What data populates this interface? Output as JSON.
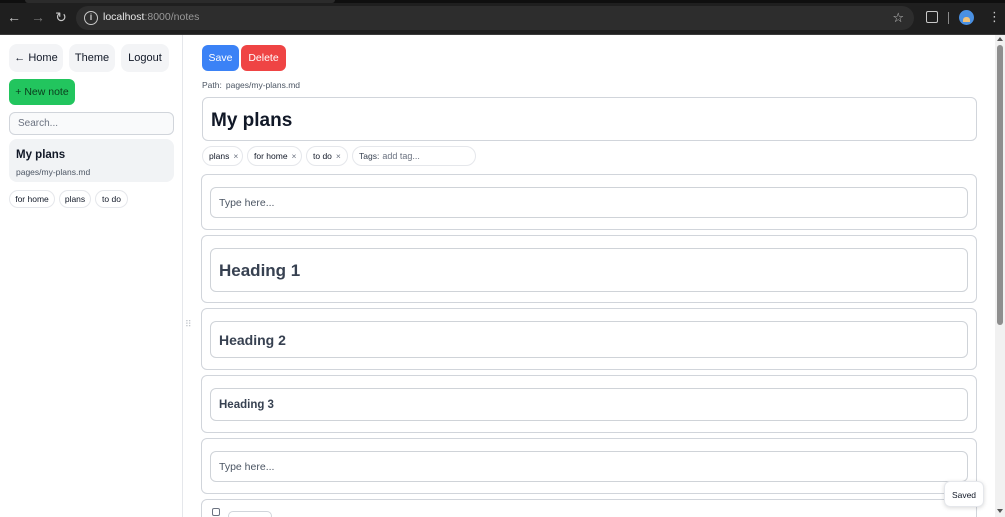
{
  "browser": {
    "url_host": "localhost",
    "url_rest": ":8000/notes",
    "icons": [
      "back-arrow-icon",
      "forward-arrow-icon",
      "reload-icon",
      "info-icon",
      "star-icon",
      "extensions-icon",
      "profile-icon",
      "kebab-menu-icon"
    ]
  },
  "sidebar": {
    "home_label": "← Home",
    "theme_label": "Theme",
    "logout_label": "Logout",
    "new_note_label": "+ New note",
    "search_placeholder": "Search...",
    "notes": [
      {
        "title": "My plans",
        "path": "pages/my-plans.md"
      }
    ],
    "tags": [
      "for home",
      "plans",
      "to do"
    ]
  },
  "toolbar": {
    "save_label": "Save",
    "delete_label": "Delete"
  },
  "editor": {
    "path_label": "Path:",
    "path_value": "pages/my-plans.md",
    "title": "My plans",
    "tags": [
      {
        "label": "plans",
        "remove": "×"
      },
      {
        "label": "for home",
        "remove": "×"
      },
      {
        "label": "to do",
        "remove": "×"
      }
    ],
    "tags_input_label": "Tags:",
    "tags_input_placeholder": "add tag...",
    "blocks": [
      {
        "kind": "text",
        "text": "Type here..."
      },
      {
        "kind": "heading1",
        "text": "Heading 1"
      },
      {
        "kind": "heading2",
        "text": "Heading 2"
      },
      {
        "kind": "heading3",
        "text": "Heading 3"
      },
      {
        "kind": "text",
        "text": "Type here..."
      }
    ]
  },
  "status": {
    "saved_label": "Saved"
  },
  "colors": {
    "save": "#3b82f6",
    "delete": "#ef4444",
    "new_note": "#22c55e"
  }
}
